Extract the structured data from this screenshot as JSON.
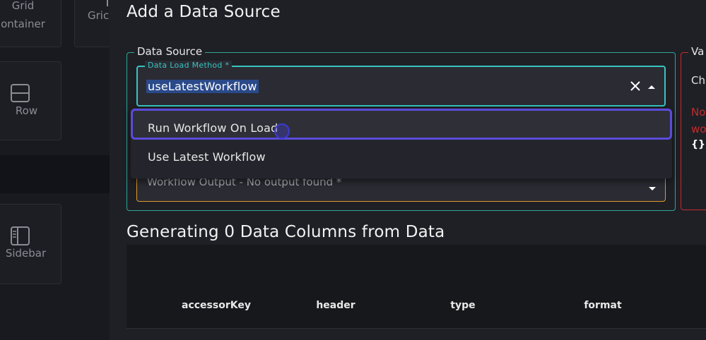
{
  "components": {
    "grid_container": {
      "line1": "Grid",
      "line2": "ontainer"
    },
    "grid_partial": "Gric",
    "row": "Row",
    "sidebar": "Sidebar"
  },
  "modal": {
    "title": "Add a Data Source",
    "data_source": {
      "legend": "Data Source",
      "load_method": {
        "label": "Data Load Method *",
        "value": "useLatestWorkflow",
        "options": [
          "Run Workflow On Load",
          "Use Latest Workflow"
        ]
      },
      "workflow_output": {
        "placeholder": "Workflow Output - No output found *"
      }
    },
    "validation": {
      "legend": "Va",
      "text": "Ch",
      "error_line1": "No",
      "error_line2": "wo",
      "brace": "{}"
    },
    "columns": {
      "title": "Generating 0 Data Columns from Data",
      "headers": [
        "accessorKey",
        "header",
        "type",
        "format"
      ]
    }
  },
  "colors": {
    "accent_teal": "#37c5c0",
    "focus_purple": "#5b4bdb",
    "error_red": "#c62b2b",
    "warning_orange": "#e39a2b"
  }
}
